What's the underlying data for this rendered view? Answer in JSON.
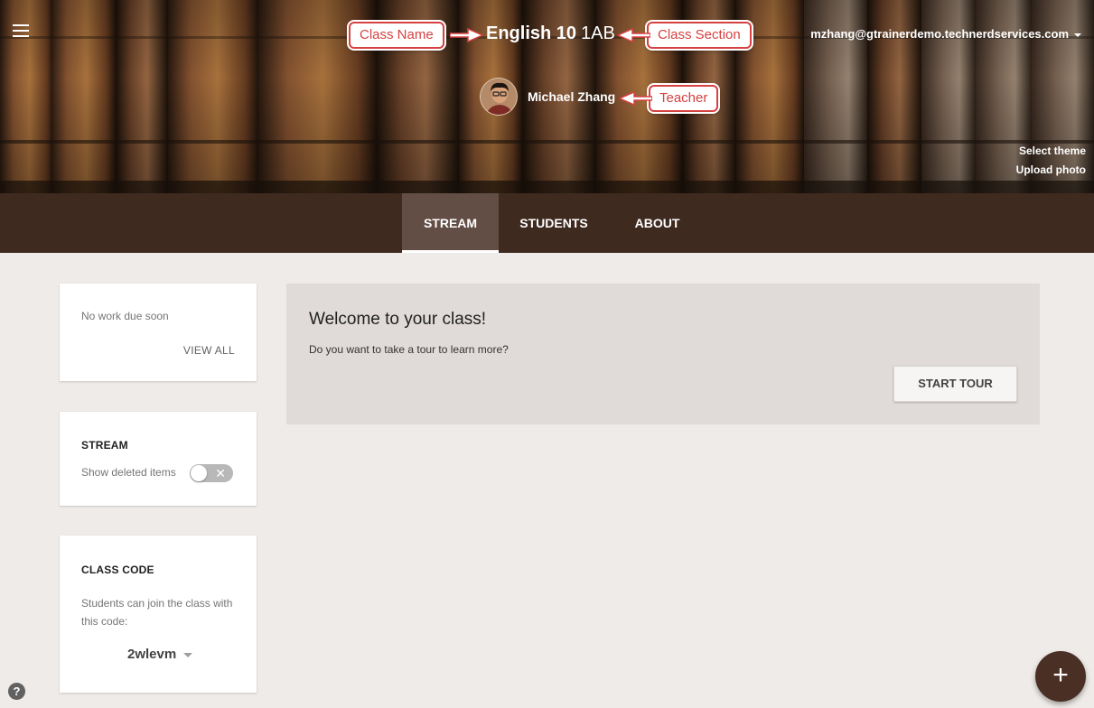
{
  "header": {
    "class_name": "English 10",
    "class_section": "1AB",
    "teacher_name": "Michael Zhang",
    "account_email": "mzhang@gtrainerdemo.technerdservices.com",
    "select_theme": "Select theme",
    "upload_photo": "Upload photo"
  },
  "callouts": {
    "class_name": "Class Name",
    "class_section": "Class Section",
    "teacher": "Teacher"
  },
  "tabs": [
    {
      "label": "STREAM",
      "active": true
    },
    {
      "label": "STUDENTS",
      "active": false
    },
    {
      "label": "ABOUT",
      "active": false
    }
  ],
  "upcoming": {
    "text": "No work due soon",
    "view_all": "VIEW ALL"
  },
  "stream_settings": {
    "heading": "STREAM",
    "toggle_label": "Show deleted items",
    "toggle_on": false
  },
  "class_code": {
    "heading": "CLASS CODE",
    "description": "Students can join the class with this code:",
    "code": "2wlevm"
  },
  "welcome": {
    "title": "Welcome to your class!",
    "subtitle": "Do you want to take a tour to learn more?",
    "button": "START TOUR"
  },
  "help_icon": "?",
  "fab_icon": "+",
  "colors": {
    "tab_bar": "#3f2a20",
    "active_tab": "#624e45",
    "callout": "#d64141",
    "fab": "#4a2f24",
    "page_bg": "#efebe8"
  }
}
